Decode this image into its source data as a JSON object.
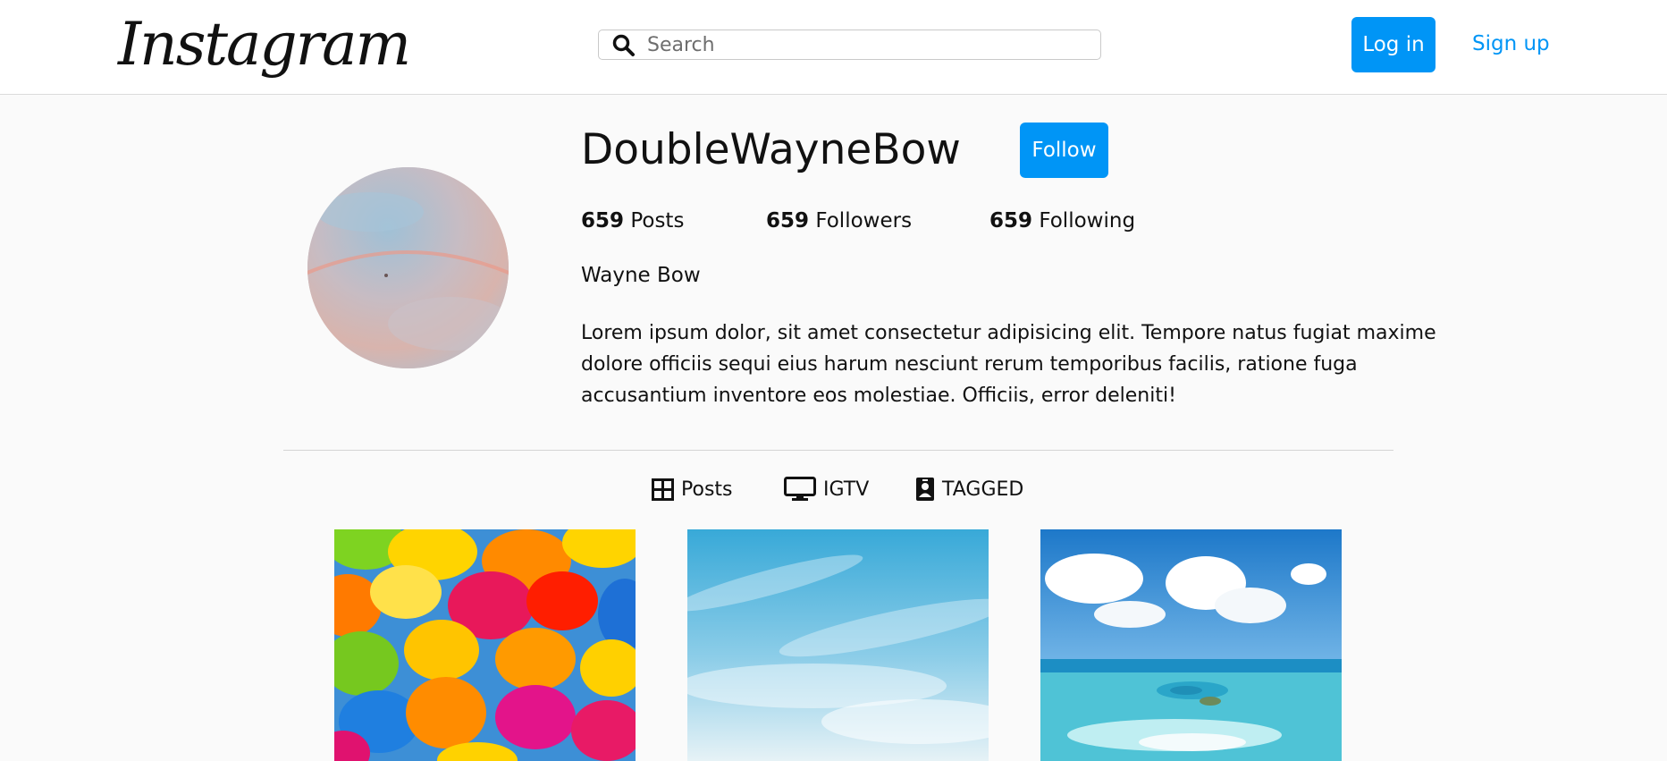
{
  "header": {
    "logo_text": "Instagram",
    "search": {
      "placeholder": "Search",
      "value": ""
    },
    "login_label": "Log in",
    "signup_label": "Sign up"
  },
  "profile": {
    "username": "DoubleWayneBow",
    "follow_label": "Follow",
    "stats": {
      "posts_count": "659",
      "posts_label": "Posts",
      "followers_count": "659",
      "followers_label": "Followers",
      "following_count": "659",
      "following_label": "Following"
    },
    "full_name": "Wayne Bow",
    "bio": "Lorem ipsum dolor, sit amet consectetur adipisicing elit. Tempore natus fugiat maxime dolore officiis sequi eius harum nesciunt rerum temporibus facilis, ratione fuga accusantium inventore eos molestiae. Officiis, error deleniti!"
  },
  "tabs": [
    {
      "label": "Posts",
      "icon": "grid-icon"
    },
    {
      "label": "IGTV",
      "icon": "tv-icon"
    },
    {
      "label": "TAGGED",
      "icon": "tagged-icon"
    }
  ],
  "posts": [
    {
      "subject": "colorful umbrellas"
    },
    {
      "subject": "blue sky"
    },
    {
      "subject": "tropical island"
    }
  ],
  "colors": {
    "accent": "#0095f6",
    "background": "#fafafa",
    "header_bg": "#ffffff"
  }
}
